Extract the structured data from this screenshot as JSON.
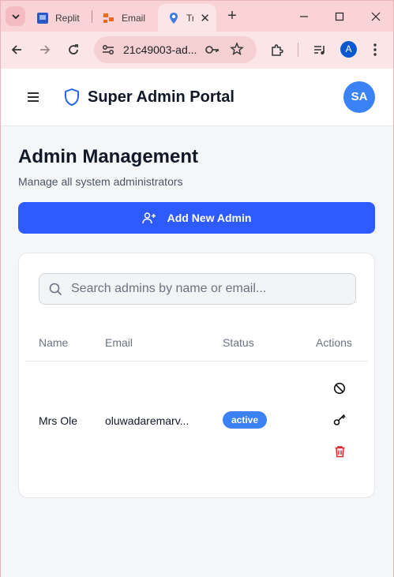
{
  "browser": {
    "tabs": [
      {
        "title": "Replit",
        "favicon": "replit-icon"
      },
      {
        "title": "Email",
        "favicon": "email-icon"
      },
      {
        "title": "Tr",
        "favicon": "location-pin-icon",
        "active": true
      }
    ],
    "url": "21c49003-ad...",
    "profile_initial": "A"
  },
  "header": {
    "title": "Super Admin Portal",
    "avatar_initials": "SA"
  },
  "main": {
    "title": "Admin Management",
    "subtitle": "Manage all system administrators",
    "add_button_label": "Add New Admin",
    "search_placeholder": "Search admins by name or email...",
    "columns": [
      "Name",
      "Email",
      "Status",
      "Actions"
    ],
    "rows": [
      {
        "name": "Mrs Ole",
        "email": "oluwadaremarv...",
        "status": "active"
      }
    ]
  },
  "colors": {
    "primary_button": "#2e5bff",
    "avatar": "#3b82f6",
    "status_active": "#3b82f6",
    "delete_icon": "#dc2626",
    "tab_strip": "#f9d3d6"
  }
}
